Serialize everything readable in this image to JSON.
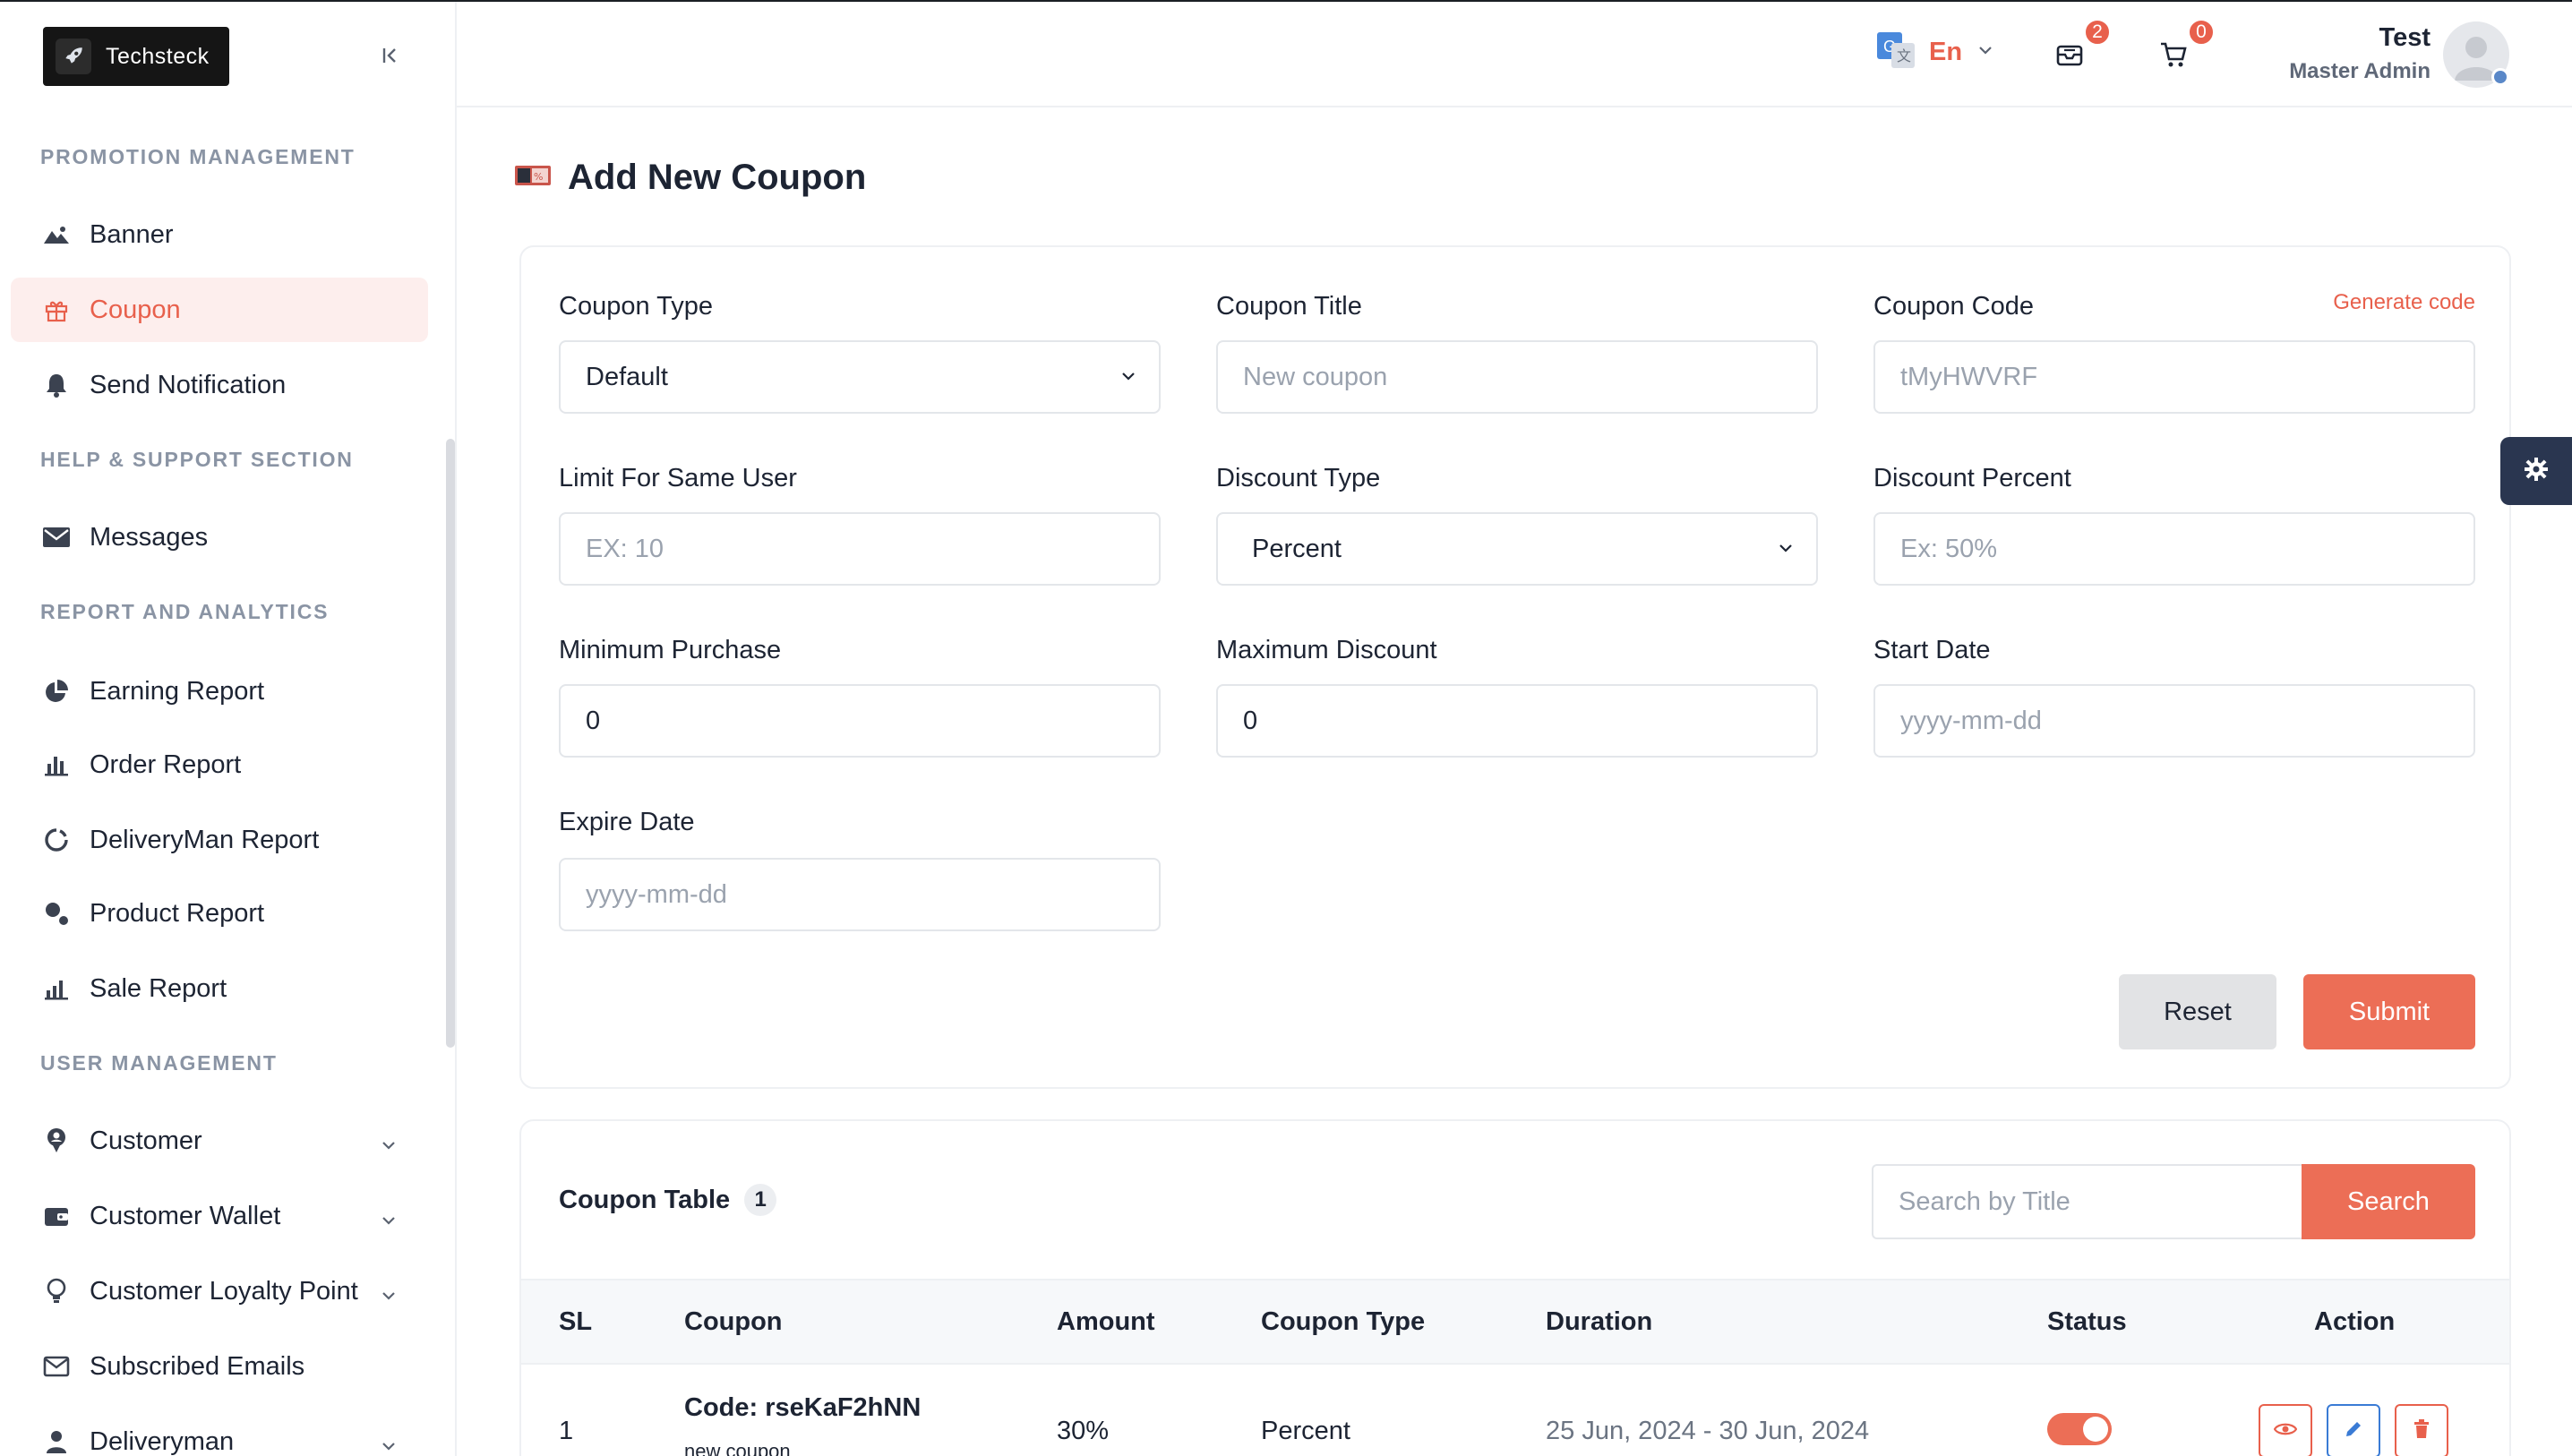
{
  "brand": {
    "name": "Techsteck"
  },
  "sidebar": {
    "sections": {
      "promotion": "PROMOTION MANAGEMENT",
      "help": "HELP & SUPPORT SECTION",
      "report": "REPORT AND ANALYTICS",
      "user": "USER MANAGEMENT"
    },
    "items": {
      "banner": "Banner",
      "coupon": "Coupon",
      "send_notification": "Send Notification",
      "messages": "Messages",
      "earning_report": "Earning Report",
      "order_report": "Order Report",
      "deliveryman_report": "DeliveryMan Report",
      "product_report": "Product Report",
      "sale_report": "Sale Report",
      "customer": "Customer",
      "customer_wallet": "Customer Wallet",
      "customer_loyalty_point": "Customer Loyalty Point",
      "subscribed_emails": "Subscribed Emails",
      "deliveryman": "Deliveryman"
    },
    "active_item": "coupon"
  },
  "header": {
    "language": "En",
    "messages_count": "2",
    "cart_count": "0",
    "user": {
      "name": "Test",
      "role": "Master Admin"
    }
  },
  "page": {
    "title": "Add New Coupon"
  },
  "form": {
    "coupon_type": {
      "label": "Coupon Type",
      "value": "Default"
    },
    "coupon_title": {
      "label": "Coupon Title",
      "placeholder": "New coupon"
    },
    "coupon_code": {
      "label": "Coupon Code",
      "placeholder": "tMyHWVRF",
      "generate_label": "Generate code"
    },
    "limit_same_user": {
      "label": "Limit For Same User",
      "placeholder": "EX: 10"
    },
    "discount_type": {
      "label": "Discount Type",
      "value": "Percent"
    },
    "discount_percent": {
      "label": "Discount Percent",
      "placeholder": "Ex: 50%"
    },
    "minimum_purchase": {
      "label": "Minimum Purchase",
      "value": "0"
    },
    "maximum_discount": {
      "label": "Maximum Discount",
      "value": "0"
    },
    "start_date": {
      "label": "Start Date",
      "placeholder": "yyyy-mm-dd"
    },
    "expire_date": {
      "label": "Expire Date",
      "placeholder": "yyyy-mm-dd"
    },
    "reset_label": "Reset",
    "submit_label": "Submit"
  },
  "table": {
    "title": "Coupon Table",
    "count": "1",
    "search_placeholder": "Search by Title",
    "search_label": "Search",
    "columns": [
      "SL",
      "Coupon",
      "Amount",
      "Coupon Type",
      "Duration",
      "Status",
      "Action"
    ],
    "rows": [
      {
        "sl": "1",
        "code": "Code: rseKaF2hNN",
        "title": "new coupon",
        "amount": "30%",
        "type": "Percent",
        "duration": "25 Jun, 2024 - 30 Jun, 2024",
        "status_on": true
      }
    ]
  },
  "colors": {
    "accent": "#e8604c",
    "sidebar_active_bg": "#fdeeed",
    "settings_tab": "#2a3650"
  }
}
